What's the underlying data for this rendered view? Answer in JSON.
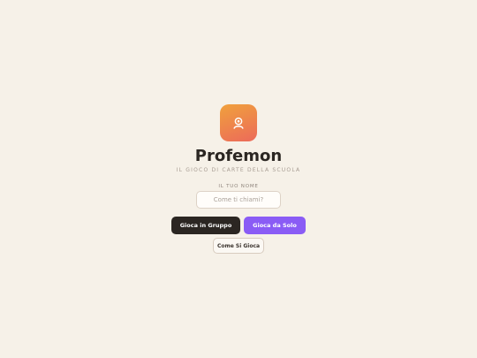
{
  "app": {
    "title": "Profemon",
    "subtitle": "IL GIOCO DI CARTE DELLA SCUOLA"
  },
  "name_field": {
    "label": "IL TUO NOME",
    "value": "",
    "placeholder": "Come ti chiami?"
  },
  "actions": {
    "group_label": "Gioca in Gruppo",
    "solo_label": "Gioca da Solo",
    "howto_label": "Come Si Gioca"
  },
  "icons": {
    "logo": "profile-badge-icon"
  },
  "colors": {
    "background": "#f6f1e8",
    "logo_gradient_start": "#f0a13c",
    "logo_gradient_end": "#ec6a5a",
    "primary_dark": "#2b2622",
    "accent_purple": "#8a5cf5"
  }
}
